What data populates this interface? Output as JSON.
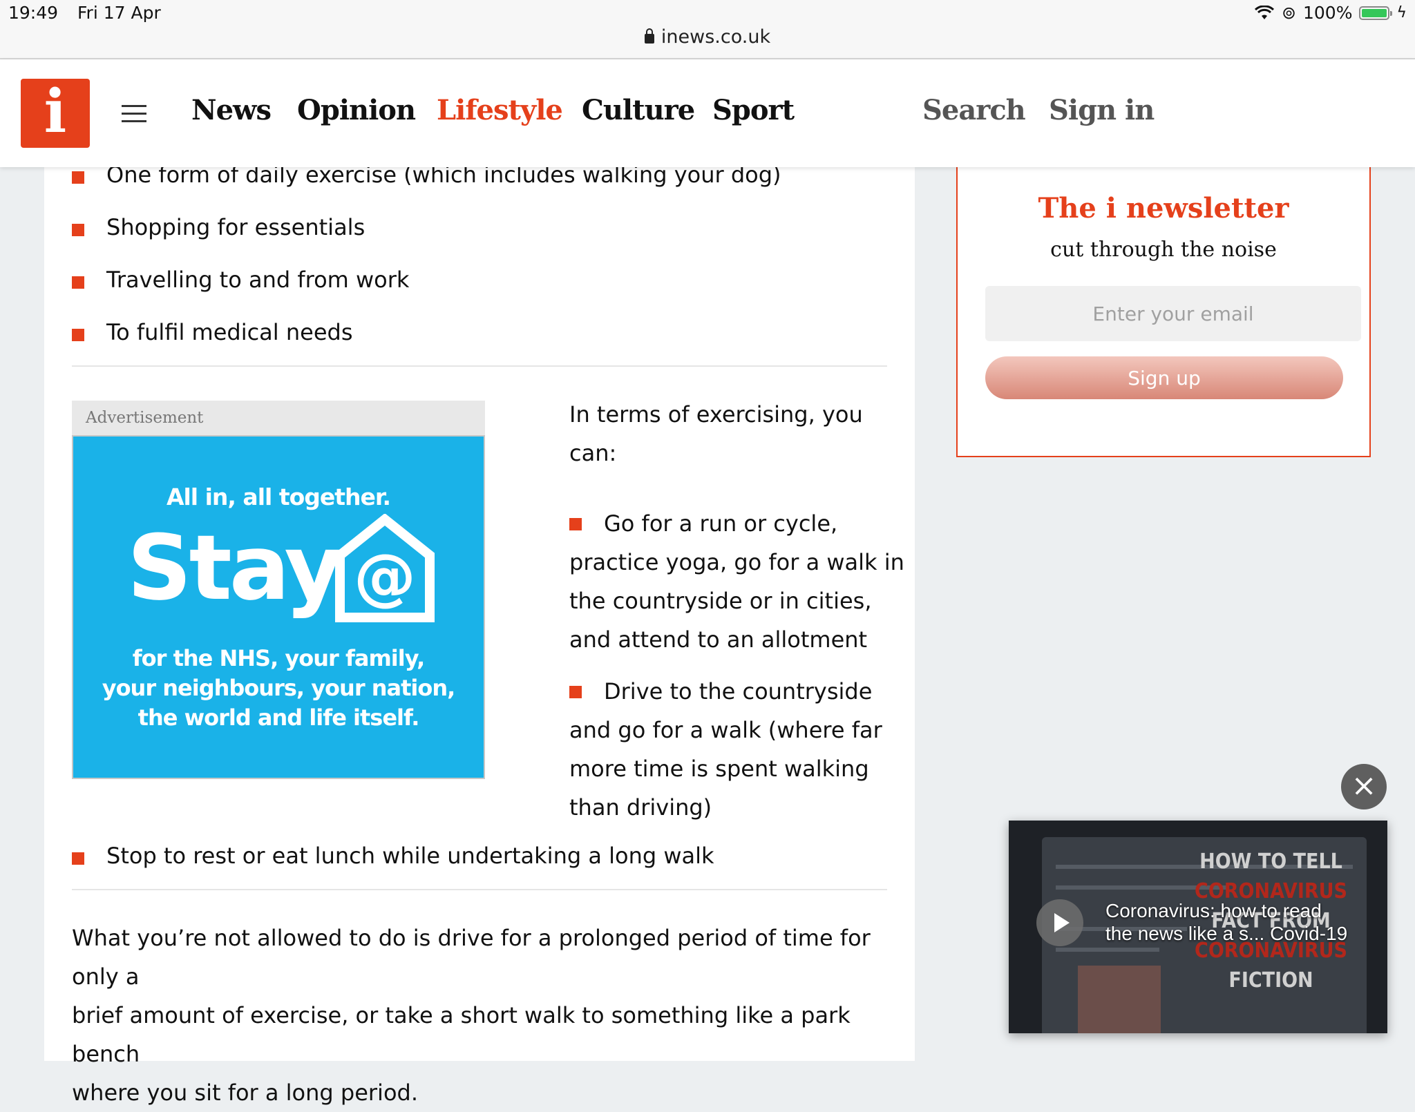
{
  "status_bar": {
    "time": "19:49",
    "date": "Fri 17 Apr",
    "url": "inews.co.uk",
    "battery": "100%"
  },
  "header": {
    "logo": "i",
    "nav": [
      "News",
      "Opinion",
      "Lifestyle",
      "Culture",
      "Sport"
    ],
    "active": "Lifestyle",
    "search": "Search",
    "sign_in": "Sign in"
  },
  "article": {
    "top_bullets": [
      "One form of daily exercise (which includes walking your dog)",
      "Shopping for essentials",
      "Travelling to and from work",
      "To fulfil medical needs"
    ],
    "ad": {
      "label": "Advertisement",
      "headline": "All in, all together.",
      "stay": "Stay",
      "body_lines": [
        "for the NHS, your family,",
        "your neighbours, your nation,",
        "the world and life itself."
      ]
    },
    "exercise_intro_lines": [
      "In terms of exercising, you",
      "can:"
    ],
    "exercise_bullets": [
      {
        "lines": [
          "Go for a run or cycle,",
          "practice yoga, go for a walk in",
          "the countryside or in cities,",
          "and attend to an allotment"
        ]
      },
      {
        "lines": [
          "Drive to the countryside",
          "and go for a walk (where far",
          "more time is spent walking",
          "than driving)"
        ]
      }
    ],
    "last_bullet": "Stop to rest or eat lunch while undertaking a long walk",
    "closing_lines": [
      "What you’re not allowed to do is drive for a prolonged period of time for only a",
      "brief amount of exercise, or take a short walk to something like a park bench",
      "where you sit for a long period."
    ]
  },
  "newsletter": {
    "title": "The i newsletter",
    "subtitle": "cut through the noise",
    "email_placeholder": "Enter your email",
    "button": "Sign up"
  },
  "video": {
    "caption_lines": [
      "Coronavirus: how to read",
      "the news like a s... Covid-19"
    ],
    "overlay_lines": [
      "HOW TO TELL",
      "CORONAVIRUS",
      "FACT FROM",
      "CORONAVIRUS",
      "FICTION"
    ]
  },
  "colors": {
    "accent": "#e5401b",
    "ad_blue": "#1ab2e8"
  }
}
